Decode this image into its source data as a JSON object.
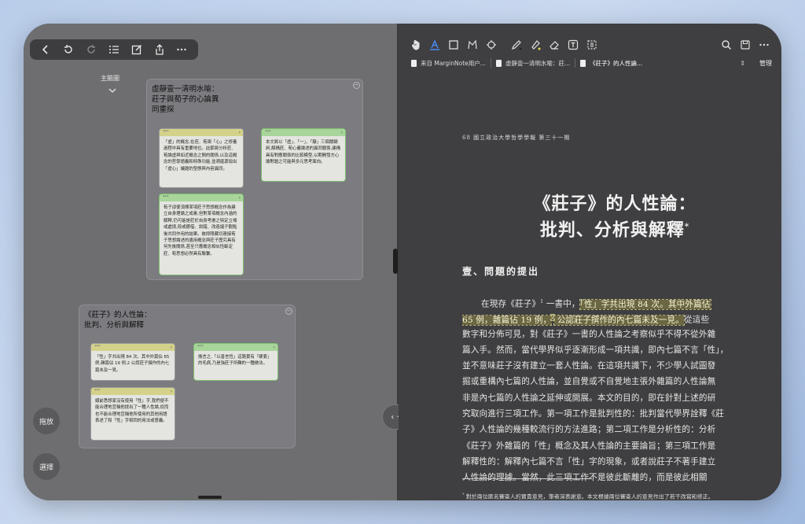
{
  "left_toolbar": {
    "icons": [
      "back-icon",
      "undo-icon",
      "redo-icon",
      "outline-list-icon",
      "edit-icon",
      "share-icon",
      "more-icon"
    ]
  },
  "mindmap": {
    "root_label": "主脑圖",
    "node1": {
      "title": "虛靜壹一清明水喻：\n莊子與荀子的心論異\n同重探",
      "notes": [
        {
          "head": "***",
          "text": "「虛」的概念,在莊、荀兩「心」之修養過程中具有重要地位。此節將分析莊、荀論虛與如近概念之間的關係,以及這概念的哲學語義和特殊功能,並溯還源說出「虛心」議題的型態與內容異同。",
          "color": "yellow"
        },
        {
          "head": "***",
          "text": "本文將以「虛」、「一」、「靜」三個關鍵詞,解構莊、荀心義論述的異同關係,建構具有對應關係的比較模型,以期開發方心論對題之可能與多元思考面向。",
          "color": "green"
        },
        {
          "head": "***",
          "text": "荀子卻便須揮某項莊子思想概念作為建立自身理論之成素,但對某項概念內涵的解釋,仍可能是莊於自身考慮之特定立場或處境,段或挪借、訓錯、改造諸子觀點後共同作用的結果。故即隱藏切連接荀子思想論述的遺用概念與莊子歷究具有何先後關係,甚至只應概念相似性斷定莊、荀思想必然具有聯繫。",
          "color": "green"
        }
      ]
    },
    "node2": {
      "title": "《莊子》的人性論：\n批判、分析與解釋",
      "notes": [
        {
          "head": "***",
          "text": "「性」字共出現 84 次。其中外篇佔 65 例,雜篇佔 19 例,2 公認莊子撰作的內七篇未及一見。",
          "color": "yellow"
        },
        {
          "head": "***",
          "text": "換言之,「以善言性」這路實有「硬套」的毛病,乃是強莊子所難的一種做法。",
          "color": "green"
        },
        {
          "head": "***",
          "text": "綴前悉想家沒有使用「性」字,我們便不能合理地宣稱他提出了一種人性論,從而也不能合理地宣稱他所使用的其他用語表述了和「性」字相同的用法或意義。",
          "color": "yellow"
        }
      ]
    },
    "side_buttons": {
      "drag": "拖放",
      "select": "選擇"
    }
  },
  "right_toolbar": {
    "icons": [
      "hand-icon",
      "text-highlight-icon",
      "rect-select-icon",
      "lasso-icon",
      "ocr-icon",
      "pen-icon",
      "highlighter-icon",
      "eraser-icon",
      "textbox-icon",
      "frame-icon"
    ],
    "right_icons": [
      "search-icon",
      "save-icon",
      "more-icon"
    ]
  },
  "tabs": {
    "items": [
      "来自 MarginNote用户...",
      "虛靜壹一清明水喻：莊...",
      "《莊子》的人性論..."
    ],
    "manage": "管理"
  },
  "document": {
    "header": "68 國立政治大學哲學學報 第三十一期",
    "title_line1": "《莊子》的人性論：",
    "title_line2": "批判、分析與解釋",
    "title_mark": "*",
    "section": "壹、問題的提出",
    "lines": [
      {
        "pre": "在現存《莊子》",
        "sup": "1",
        "mid": " 一書中，",
        "hl": "「性」字共出現 84 次。其中外篇佔",
        "post": ""
      },
      {
        "pre": "",
        "sup": "",
        "mid": "",
        "hl": "65 例，雜篇佔 19 例，",
        "post": "",
        "sup2": "2",
        "hl2": " 公認莊子撰作的內七篇未及一見。",
        "post2": "從這些"
      },
      {
        "pre": "數字和分佈可見，對《莊子》一書的人性論之考察似乎不得不從外雜",
        "sup": "",
        "mid": "",
        "hl": "",
        "post": ""
      },
      {
        "pre": "篇入手。然而，當代學界似乎逐漸形成一項共識，即內七篇不言「性」，",
        "sup": "",
        "mid": "",
        "hl": "",
        "post": ""
      },
      {
        "pre": "並不意味莊子沒有建立一套人性論。在這項共識下，不少學人試圖發",
        "sup": "",
        "mid": "",
        "hl": "",
        "post": ""
      },
      {
        "pre": "掘或重構內七篇的人性論，並自覺或不自覺地主張外雜篇的人性論無",
        "sup": "",
        "mid": "",
        "hl": "",
        "post": ""
      },
      {
        "pre": "非是內七篇的人性論之延伸或開展。本文的目的，即在針對上述的研",
        "sup": "",
        "mid": "",
        "hl": "",
        "post": ""
      },
      {
        "pre": "究取向進行三項工作。第一項工作是批判性的：批判當代學界詮釋《莊",
        "sup": "",
        "mid": "",
        "hl": "",
        "post": ""
      },
      {
        "pre": "子》人性論的幾種較流行的方法進路；第二項工作是分析性的：分析",
        "sup": "",
        "mid": "",
        "hl": "",
        "post": ""
      },
      {
        "pre": "《莊子》外雜篇的「性」概念及其人性論的主要論旨；第三項工作是",
        "sup": "",
        "mid": "",
        "hl": "",
        "post": ""
      },
      {
        "pre": "解釋性的：解釋內七篇不言「性」字的現象，或者說莊子不著手建立",
        "sup": "",
        "mid": "",
        "hl": "",
        "post": ""
      },
      {
        "pre": "人性論的理據。當然，此三項工作不是彼此斷離的，而是彼此相關",
        "sup": "",
        "mid": "",
        "hl": "",
        "post": ""
      }
    ],
    "footnote_mark": "*",
    "footnote": "對於兩位匿名審查人的寶貴意見，筆者深表謝意。本文根據兩位審查人的意見作出了若干改寫和修正。"
  },
  "colors": {
    "accent": "#4b8bf5",
    "highlight": "#6b6742",
    "note_yellow": "#d4d28a",
    "note_green": "#a8d59a"
  }
}
